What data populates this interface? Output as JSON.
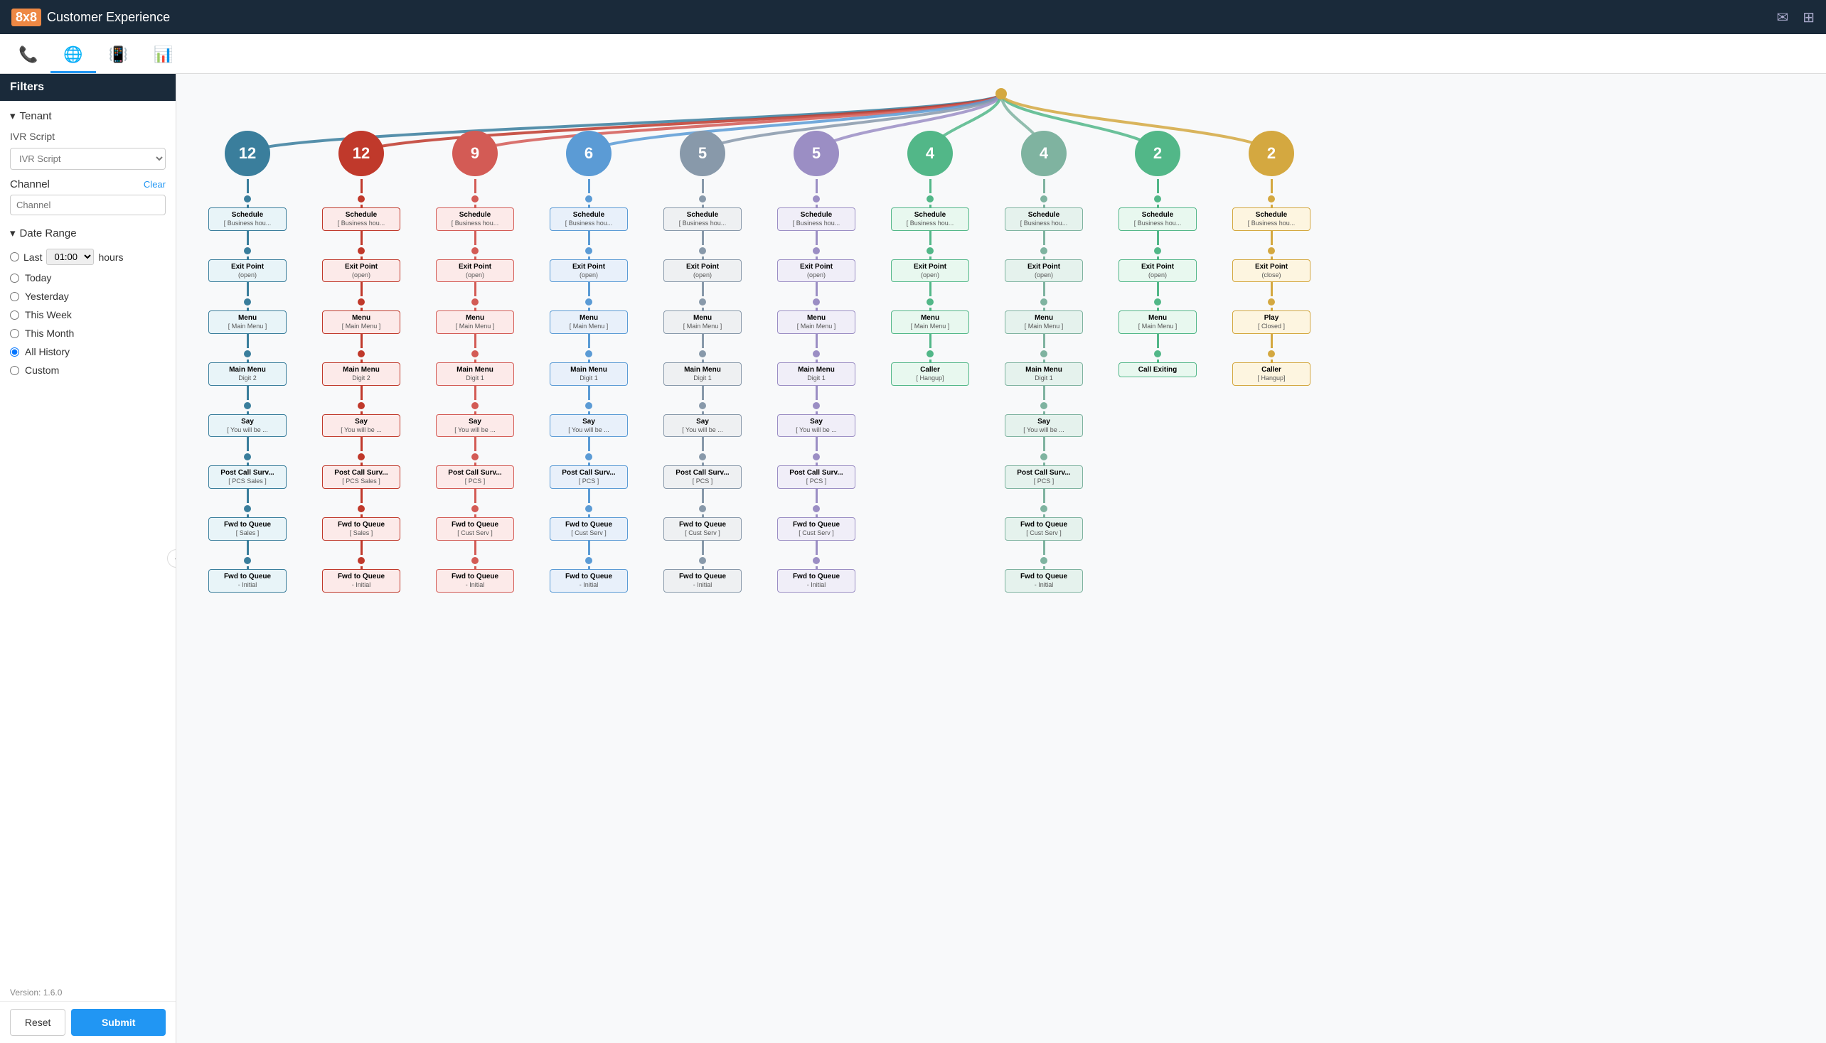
{
  "app": {
    "brand": "8x8",
    "title": "Customer Experience",
    "version": "Version: 1.6.0"
  },
  "nav": {
    "tabs": [
      {
        "id": "phone",
        "icon": "📞",
        "active": false
      },
      {
        "id": "tree",
        "icon": "🌐",
        "active": true
      },
      {
        "id": "calls",
        "icon": "📳",
        "active": false
      },
      {
        "id": "reports",
        "icon": "📊",
        "active": false
      }
    ]
  },
  "sidebar": {
    "title": "Filters",
    "tenant_section": "Tenant",
    "ivr_label": "IVR Script",
    "ivr_placeholder": "IVR Script",
    "channel_label": "Channel",
    "channel_clear": "Clear",
    "channel_placeholder": "Channel",
    "date_range_label": "Date Range",
    "date_options": [
      {
        "id": "last",
        "label": "Last",
        "hours": "01:00",
        "suffix": "hours"
      },
      {
        "id": "today",
        "label": "Today"
      },
      {
        "id": "yesterday",
        "label": "Yesterday"
      },
      {
        "id": "this_week",
        "label": "This Week"
      },
      {
        "id": "this_month",
        "label": "This Month"
      },
      {
        "id": "all_history",
        "label": "All History",
        "selected": true
      },
      {
        "id": "custom",
        "label": "Custom"
      }
    ],
    "reset_label": "Reset",
    "submit_label": "Submit"
  },
  "tree": {
    "root_value": "",
    "columns": [
      {
        "id": 0,
        "count": 12,
        "color_class": "col-0",
        "nodes": [
          {
            "type": "box",
            "title": "Schedule",
            "sub": "[ Business hou..."
          },
          {
            "type": "box",
            "title": "Exit Point",
            "sub": "(open)"
          },
          {
            "type": "box",
            "title": "Menu",
            "sub": "[ Main Menu ]"
          },
          {
            "type": "box",
            "title": "Main Menu",
            "sub": "Digit 2"
          },
          {
            "type": "box",
            "title": "Say",
            "sub": "[ You will be ..."
          },
          {
            "type": "box",
            "title": "Post Call Surv...",
            "sub": "[ PCS Sales ]"
          },
          {
            "type": "box",
            "title": "Fwd to Queue",
            "sub": "[ Sales ]"
          },
          {
            "type": "box",
            "title": "Fwd to Queue",
            "sub": "- Initial"
          }
        ]
      },
      {
        "id": 1,
        "count": 12,
        "color_class": "col-1",
        "nodes": [
          {
            "type": "box",
            "title": "Schedule",
            "sub": "[ Business hou..."
          },
          {
            "type": "box",
            "title": "Exit Point",
            "sub": "(open)"
          },
          {
            "type": "box",
            "title": "Menu",
            "sub": "[ Main Menu ]"
          },
          {
            "type": "box",
            "title": "Main Menu",
            "sub": "Digit 2"
          },
          {
            "type": "box",
            "title": "Say",
            "sub": "[ You will be ..."
          },
          {
            "type": "box",
            "title": "Post Call Surv...",
            "sub": "[ PCS Sales ]"
          },
          {
            "type": "box",
            "title": "Fwd to Queue",
            "sub": "[ Sales ]"
          },
          {
            "type": "box",
            "title": "Fwd to Queue",
            "sub": "- Initial"
          }
        ]
      },
      {
        "id": 2,
        "count": 9,
        "color_class": "col-2",
        "nodes": [
          {
            "type": "box",
            "title": "Schedule",
            "sub": "[ Business hou..."
          },
          {
            "type": "box",
            "title": "Exit Point",
            "sub": "(open)"
          },
          {
            "type": "box",
            "title": "Menu",
            "sub": "[ Main Menu ]"
          },
          {
            "type": "box",
            "title": "Main Menu",
            "sub": "Digit 1"
          },
          {
            "type": "box",
            "title": "Say",
            "sub": "[ You will be ..."
          },
          {
            "type": "box",
            "title": "Post Call Surv...",
            "sub": "[ PCS ]"
          },
          {
            "type": "box",
            "title": "Fwd to Queue",
            "sub": "[ Cust Serv ]"
          },
          {
            "type": "box",
            "title": "Fwd to Queue",
            "sub": "- Initial"
          }
        ]
      },
      {
        "id": 3,
        "count": 6,
        "color_class": "col-3",
        "nodes": [
          {
            "type": "box",
            "title": "Schedule",
            "sub": "[ Business hou..."
          },
          {
            "type": "box",
            "title": "Exit Point",
            "sub": "(open)"
          },
          {
            "type": "box",
            "title": "Menu",
            "sub": "[ Main Menu ]"
          },
          {
            "type": "box",
            "title": "Main Menu",
            "sub": "Digit 1"
          },
          {
            "type": "box",
            "title": "Say",
            "sub": "[ You will be ..."
          },
          {
            "type": "box",
            "title": "Post Call Surv...",
            "sub": "[ PCS ]"
          },
          {
            "type": "box",
            "title": "Fwd to Queue",
            "sub": "[ Cust Serv ]"
          },
          {
            "type": "box",
            "title": "Fwd to Queue",
            "sub": "- Initial"
          }
        ]
      },
      {
        "id": 4,
        "count": 5,
        "color_class": "col-4",
        "nodes": [
          {
            "type": "box",
            "title": "Schedule",
            "sub": "[ Business hou..."
          },
          {
            "type": "box",
            "title": "Exit Point",
            "sub": "(open)"
          },
          {
            "type": "box",
            "title": "Menu",
            "sub": "[ Main Menu ]"
          },
          {
            "type": "box",
            "title": "Main Menu",
            "sub": "Digit 1"
          },
          {
            "type": "box",
            "title": "Say",
            "sub": "[ You will be ..."
          },
          {
            "type": "box",
            "title": "Post Call Surv...",
            "sub": "[ PCS ]"
          },
          {
            "type": "box",
            "title": "Fwd to Queue",
            "sub": "[ Cust Serv ]"
          },
          {
            "type": "box",
            "title": "Fwd to Queue",
            "sub": "- Initial"
          }
        ]
      },
      {
        "id": 5,
        "count": 5,
        "color_class": "col-5",
        "nodes": [
          {
            "type": "box",
            "title": "Schedule",
            "sub": "[ Business hou..."
          },
          {
            "type": "box",
            "title": "Exit Point",
            "sub": "(open)"
          },
          {
            "type": "box",
            "title": "Menu",
            "sub": "[ Main Menu ]"
          },
          {
            "type": "box",
            "title": "Main Menu",
            "sub": "Digit 1"
          },
          {
            "type": "box",
            "title": "Say",
            "sub": "[ You will be ..."
          },
          {
            "type": "box",
            "title": "Post Call Surv...",
            "sub": "[ PCS ]"
          },
          {
            "type": "box",
            "title": "Fwd to Queue",
            "sub": "[ Cust Serv ]"
          },
          {
            "type": "box",
            "title": "Fwd to Queue",
            "sub": "- Initial"
          }
        ]
      },
      {
        "id": 6,
        "count": 4,
        "color_class": "col-6",
        "nodes": [
          {
            "type": "box",
            "title": "Schedule",
            "sub": "[ Business hou..."
          },
          {
            "type": "box",
            "title": "Exit Point",
            "sub": "(open)"
          },
          {
            "type": "box",
            "title": "Menu",
            "sub": "[ Main Menu ]"
          },
          {
            "type": "box",
            "title": "Caller",
            "sub": "[ Hangup]"
          },
          {
            "type": "box",
            "title": "",
            "sub": ""
          },
          {
            "type": "box",
            "title": "",
            "sub": ""
          },
          {
            "type": "box",
            "title": "",
            "sub": ""
          },
          {
            "type": "box",
            "title": "",
            "sub": ""
          }
        ]
      },
      {
        "id": 7,
        "count": 4,
        "color_class": "col-7",
        "nodes": [
          {
            "type": "box",
            "title": "Schedule",
            "sub": "[ Business hou..."
          },
          {
            "type": "box",
            "title": "Exit Point",
            "sub": "(open)"
          },
          {
            "type": "box",
            "title": "Menu",
            "sub": "[ Main Menu ]"
          },
          {
            "type": "box",
            "title": "Main Menu",
            "sub": "Digit 1"
          },
          {
            "type": "box",
            "title": "Say",
            "sub": "[ You will be ..."
          },
          {
            "type": "box",
            "title": "Post Call Surv...",
            "sub": "[ PCS ]"
          },
          {
            "type": "box",
            "title": "Fwd to Queue",
            "sub": "[ Cust Serv ]"
          },
          {
            "type": "box",
            "title": "Fwd to Queue",
            "sub": "- Initial"
          }
        ]
      },
      {
        "id": 8,
        "count": 2,
        "color_class": "col-8",
        "nodes": [
          {
            "type": "box",
            "title": "Schedule",
            "sub": "[ Business hou..."
          },
          {
            "type": "box",
            "title": "Exit Point",
            "sub": "(open)"
          },
          {
            "type": "box",
            "title": "Menu",
            "sub": "[ Main Menu ]"
          },
          {
            "type": "box",
            "title": "Call Exiting",
            "sub": ""
          },
          {
            "type": "box",
            "title": "",
            "sub": ""
          },
          {
            "type": "box",
            "title": "",
            "sub": ""
          },
          {
            "type": "box",
            "title": "",
            "sub": ""
          },
          {
            "type": "box",
            "title": "",
            "sub": ""
          }
        ]
      },
      {
        "id": 9,
        "count": 2,
        "color_class": "col-9",
        "nodes": [
          {
            "type": "box",
            "title": "Schedule",
            "sub": "[ Business hou..."
          },
          {
            "type": "box",
            "title": "Exit Point",
            "sub": "(close)"
          },
          {
            "type": "box",
            "title": "Play",
            "sub": "[ Closed ]"
          },
          {
            "type": "box",
            "title": "Caller",
            "sub": "[ Hangup]"
          },
          {
            "type": "box",
            "title": "",
            "sub": ""
          },
          {
            "type": "box",
            "title": "",
            "sub": ""
          },
          {
            "type": "box",
            "title": "",
            "sub": ""
          },
          {
            "type": "box",
            "title": "",
            "sub": ""
          }
        ]
      }
    ]
  }
}
